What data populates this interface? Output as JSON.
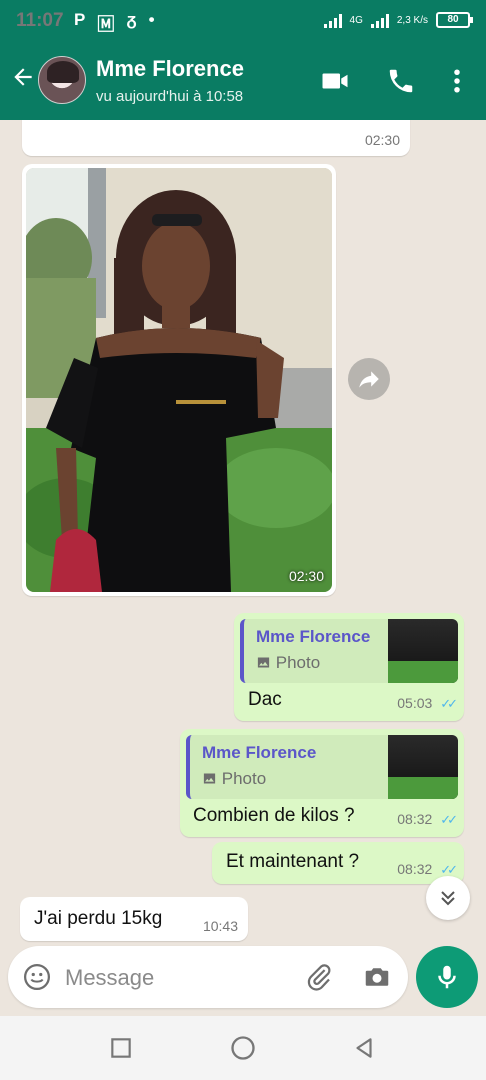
{
  "status_bar": {
    "time": "11:07",
    "indicators": [
      "P",
      "🄼",
      "ᵹ",
      "•"
    ],
    "network": "4G",
    "speed": "2,3 K/s",
    "battery": "80"
  },
  "header": {
    "contact_name": "Mme Florence",
    "last_seen": "vu aujourd'hui à 10:58",
    "icons": [
      "back-arrow-icon",
      "video-call-icon",
      "phone-icon",
      "more-options-icon"
    ]
  },
  "messages": {
    "top_time": "02:30",
    "photo": {
      "time": "02:30"
    },
    "reply1": {
      "quoted_name": "Mme Florence",
      "quoted_type": "Photo",
      "text": "Dac",
      "time": "05:03"
    },
    "reply2": {
      "quoted_name": "Mme Florence",
      "quoted_type": "Photo",
      "text": "Combien de kilos ?",
      "time": "08:32"
    },
    "msg3": {
      "text": "Et maintenant ?",
      "time": "08:32"
    },
    "msg4": {
      "text": "J'ai perdu 15kg",
      "time": "10:43"
    }
  },
  "composer": {
    "placeholder": "Message"
  },
  "colors": {
    "header": "#0a7c63",
    "chat_bg": "#ece5dd",
    "outgoing": "#dcf8c6",
    "incoming": "#ffffff",
    "read_ticks": "#4fb6ec",
    "mic": "#0d9b76",
    "quote_accent": "#5b56c9"
  }
}
